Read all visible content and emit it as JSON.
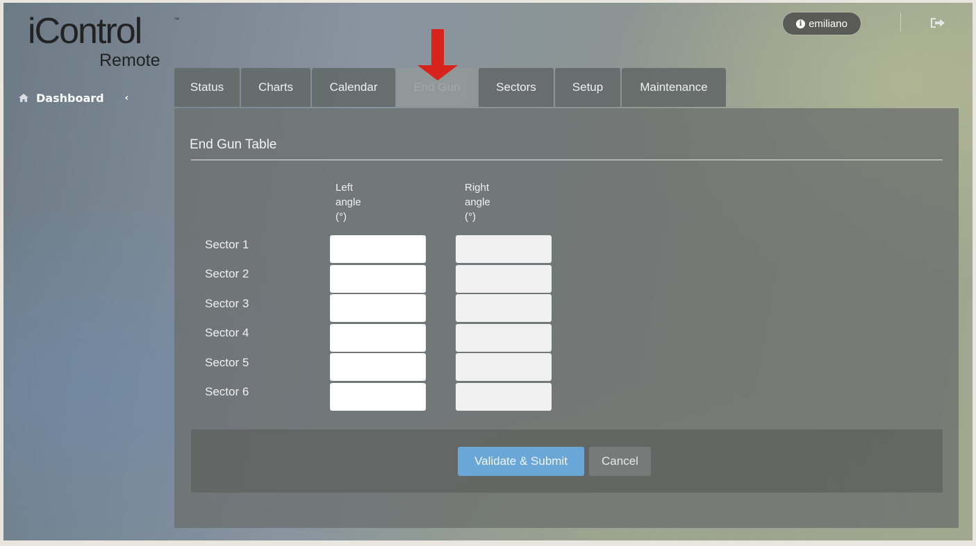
{
  "logo": {
    "main": "iControl",
    "trademark": "™",
    "sub": "Remote"
  },
  "sidebar": {
    "items": [
      {
        "label": "Dashboard",
        "icon": "home-icon",
        "toggle_icon": "chevron-left-icon"
      }
    ]
  },
  "header": {
    "user": "emiliano",
    "info_icon": "info-icon",
    "logout_icon": "logout-icon"
  },
  "tabs": [
    {
      "label": "Status"
    },
    {
      "label": "Charts"
    },
    {
      "label": "Calendar"
    },
    {
      "label": "End Gun",
      "active": true
    },
    {
      "label": "Sectors"
    },
    {
      "label": "Setup"
    },
    {
      "label": "Maintenance"
    }
  ],
  "annotation": {
    "arrow_color": "#d8231c"
  },
  "table": {
    "title": "End Gun Table",
    "columns": [
      {
        "line1": "Left",
        "line2": "angle",
        "line3": "(°)"
      },
      {
        "line1": "Right",
        "line2": "angle",
        "line3": "(°)"
      }
    ],
    "rows": [
      {
        "label": "Sector 1",
        "left": "",
        "right": ""
      },
      {
        "label": "Sector 2",
        "left": "",
        "right": ""
      },
      {
        "label": "Sector 3",
        "left": "",
        "right": ""
      },
      {
        "label": "Sector 4",
        "left": "",
        "right": ""
      },
      {
        "label": "Sector 5",
        "left": "",
        "right": ""
      },
      {
        "label": "Sector 6",
        "left": "",
        "right": ""
      }
    ]
  },
  "actions": {
    "submit_label": "Validate & Submit",
    "cancel_label": "Cancel"
  },
  "colors": {
    "accent": "#6aa6d6",
    "panel": "#6c706e"
  }
}
